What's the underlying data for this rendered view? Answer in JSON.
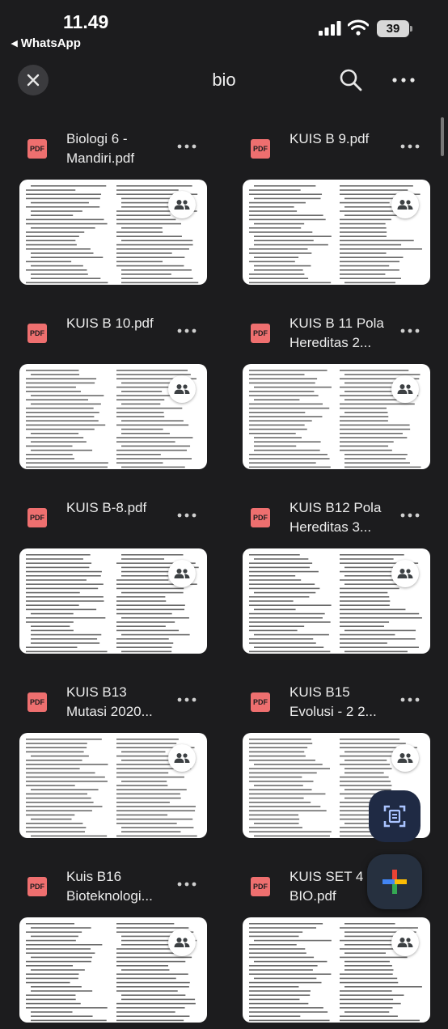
{
  "status_bar": {
    "time": "11.49",
    "back_app": "◂ WhatsApp",
    "battery": "39"
  },
  "header": {
    "title": "bio"
  },
  "files": [
    {
      "name": "Biologi 6 - Mandiri.pdf",
      "badge": "PDF"
    },
    {
      "name": "KUIS B 9.pdf",
      "badge": "PDF"
    },
    {
      "name": "KUIS B 10.pdf",
      "badge": "PDF"
    },
    {
      "name": "KUIS B 11 Pola Hereditas 2...",
      "badge": "PDF"
    },
    {
      "name": "KUIS B-8.pdf",
      "badge": "PDF"
    },
    {
      "name": "KUIS B12 Pola Hereditas 3...",
      "badge": "PDF"
    },
    {
      "name": "KUIS B13 Mutasi 2020...",
      "badge": "PDF"
    },
    {
      "name": "KUIS B15 Evolusi - 2 2...",
      "badge": "PDF"
    },
    {
      "name": "Kuis B16 Bioteknologi...",
      "badge": "PDF"
    },
    {
      "name": "KUIS SET 4 BIO.pdf",
      "badge": "PDF"
    }
  ],
  "icons": {
    "close": "close-icon",
    "search": "search-icon",
    "more": "more-vert-icon",
    "file_type": "pdf-icon",
    "shared": "shared-people-icon",
    "scan": "document-scan-icon",
    "create": "plus-icon"
  },
  "colors": {
    "background": "#1c1c1e",
    "pdf_badge": "#ee6f6f",
    "text": "#ececec",
    "thumb": "#ffffff"
  }
}
